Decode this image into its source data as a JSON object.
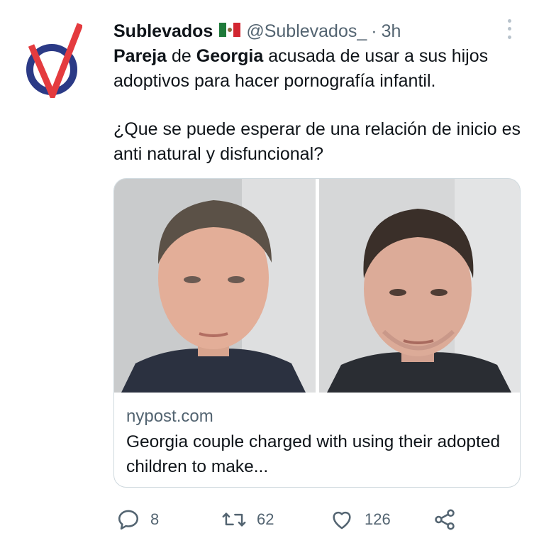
{
  "tweet": {
    "display_name": "Sublevados",
    "flag_icon": "mexico-flag-icon",
    "handle": "@Sublevados_",
    "separator": "·",
    "time": "3h",
    "text": {
      "p1_b1": "Pareja",
      "p1_t1": " de ",
      "p1_b2": "Georgia",
      "p1_t2": " acusada de usar a sus hijos adoptivos para hacer pornografía infantil.",
      "p2": "¿Que se puede esperar de una relación de inicio es anti natural y disfuncional?"
    },
    "card": {
      "domain": "nypost.com",
      "title": "Georgia couple charged with using their adopted children to make..."
    },
    "actions": {
      "reply_count": "8",
      "retweet_count": "62",
      "like_count": "126"
    }
  },
  "colors": {
    "avatar_navy": "#2b3a86",
    "avatar_red": "#e43b3f",
    "secondary_text": "#536471",
    "border": "#cfd9de"
  }
}
